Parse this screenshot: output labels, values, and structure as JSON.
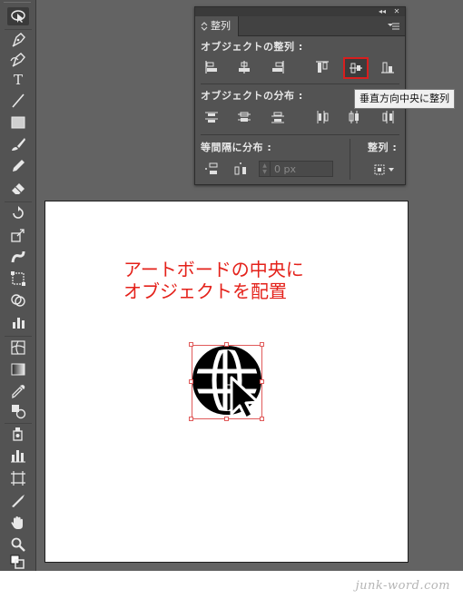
{
  "panel": {
    "tab_label": "整列",
    "collapse_glyph": "◂◂",
    "close_glyph": "✕",
    "align_objects_label": "オブジェクトの整列 :",
    "distribute_objects_label": "オブジェクトの分布 :",
    "distribute_spacing_label": "等間隔に分布 :",
    "align_to_label": "整列 :",
    "spacing_value": "0 px",
    "highlighted_button": "vertical-align-center",
    "highlight_color": "#d71e1e"
  },
  "tooltip": {
    "text": "垂直方向中央に整列"
  },
  "artboard": {
    "heading": "アートボードの中央に\nオブジェクトを配置",
    "heading_color": "#e4211a",
    "object_icon": "globe-cursor-icon"
  },
  "toolbar": {
    "text_tool_glyph": "T"
  },
  "footer": {
    "watermark": "junk-word.com"
  }
}
